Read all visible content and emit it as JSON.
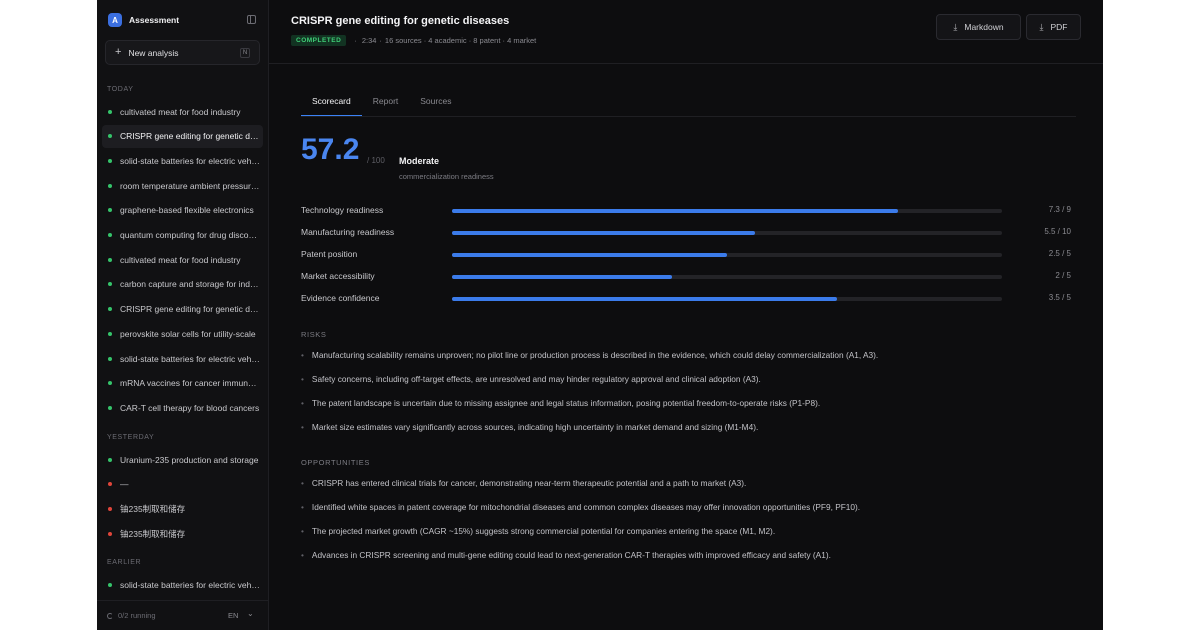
{
  "sidebar": {
    "brand_initial": "A",
    "brand_name": "Assessment",
    "new_button": "New analysis",
    "new_shortcut": "N",
    "groups": [
      {
        "label": "TODAY",
        "items": [
          {
            "text": "cultivated meat for food industry",
            "status": "green"
          },
          {
            "text": "CRISPR gene editing for genetic diseases",
            "status": "green",
            "active": true
          },
          {
            "text": "solid-state batteries for electric vehicles",
            "status": "green"
          },
          {
            "text": "room temperature ambient pressure superconductors",
            "status": "green"
          },
          {
            "text": "graphene-based flexible electronics",
            "status": "green"
          },
          {
            "text": "quantum computing for drug discovery",
            "status": "green"
          },
          {
            "text": "cultivated meat for food industry",
            "status": "green"
          },
          {
            "text": "carbon capture and storage for industry",
            "status": "green"
          },
          {
            "text": "CRISPR gene editing for genetic diseases",
            "status": "green"
          },
          {
            "text": "perovskite solar cells for utility-scale",
            "status": "green"
          },
          {
            "text": "solid-state batteries for electric vehicles",
            "status": "green"
          },
          {
            "text": "mRNA vaccines for cancer immunotherapy",
            "status": "green"
          },
          {
            "text": "CAR-T cell therapy for blood cancers",
            "status": "green"
          }
        ]
      },
      {
        "label": "YESTERDAY",
        "items": [
          {
            "text": "Uranium-235 production and storage",
            "status": "green"
          },
          {
            "text": "—",
            "status": "red"
          },
          {
            "text": "铀235制取和储存",
            "status": "red"
          },
          {
            "text": "铀235制取和储存",
            "status": "red"
          }
        ]
      },
      {
        "label": "EARLIER",
        "items": [
          {
            "text": "solid-state batteries for electric vehicles",
            "status": "green"
          }
        ]
      }
    ],
    "running": "0/2 running",
    "language": "EN"
  },
  "header": {
    "title": "CRISPR gene editing for genetic diseases",
    "status": "COMPLETED",
    "duration": "2:34",
    "sources": "16 sources · 4 academic · 8 patent · 4 market",
    "export_markdown": "Markdown",
    "export_pdf": "PDF"
  },
  "tabs": [
    "Scorecard",
    "Report",
    "Sources"
  ],
  "scorecard": {
    "score": "57.2",
    "score_max": "/ 100",
    "verdict": "Moderate",
    "verdict_sub": "commercialization readiness",
    "metrics": [
      {
        "label": "Technology readiness",
        "value": "7.3 / 9",
        "fraction": 0.811
      },
      {
        "label": "Manufacturing readiness",
        "value": "5.5 / 10",
        "fraction": 0.55
      },
      {
        "label": "Patent position",
        "value": "2.5 / 5",
        "fraction": 0.5
      },
      {
        "label": "Market accessibility",
        "value": "2 / 5",
        "fraction": 0.4
      },
      {
        "label": "Evidence confidence",
        "value": "3.5 / 5",
        "fraction": 0.7
      }
    ]
  },
  "risks": {
    "heading": "RISKS",
    "items": [
      "Manufacturing scalability remains unproven; no pilot line or production process is described in the evidence, which could delay commercialization (A1, A3).",
      "Safety concerns, including off-target effects, are unresolved and may hinder regulatory approval and clinical adoption (A3).",
      "The patent landscape is uncertain due to missing assignee and legal status information, posing potential freedom-to-operate risks (P1-P8).",
      "Market size estimates vary significantly across sources, indicating high uncertainty in market demand and sizing (M1-M4)."
    ]
  },
  "opportunities": {
    "heading": "OPPORTUNITIES",
    "items": [
      "CRISPR has entered clinical trials for cancer, demonstrating near-term therapeutic potential and a path to market (A3).",
      "Identified white spaces in patent coverage for mitochondrial diseases and common complex diseases may offer innovation opportunities (PF9, PF10).",
      "The projected market growth (CAGR ~15%) suggests strong commercial potential for companies entering the space (M1, M2).",
      "Advances in CRISPR screening and multi-gene editing could lead to next-generation CAR-T therapies with improved efficacy and safety (A1)."
    ]
  },
  "colors": {
    "accent": "#3b7bea",
    "success": "#35c46a",
    "error": "#e0453a"
  }
}
